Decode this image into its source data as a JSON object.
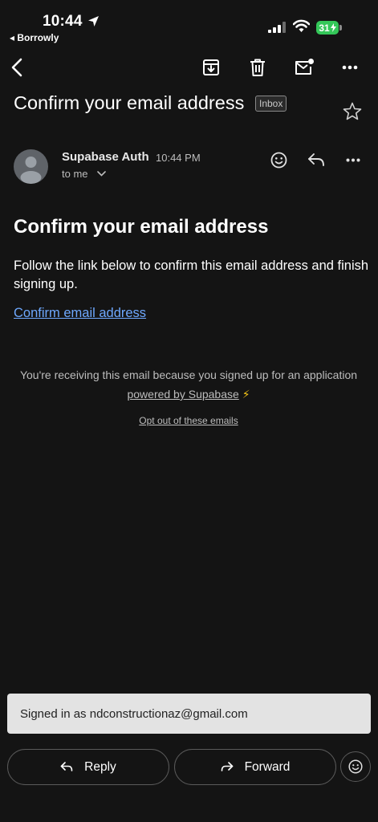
{
  "status_bar": {
    "time": "10:44",
    "back_app": "◂ Borrowly",
    "battery": "31"
  },
  "toolbar": {
    "icons": [
      "back-arrow-icon",
      "archive-icon",
      "trash-icon",
      "mark-unread-icon",
      "more-icon"
    ]
  },
  "email": {
    "subject": "Confirm your email address",
    "label": "Inbox",
    "sender": "Supabase Auth",
    "time": "10:44 PM",
    "recipient": "to me",
    "heading": "Confirm your email address",
    "body": "Follow the link below to confirm this email address and finish signing up.",
    "link_text": "Confirm email address",
    "footer_text": "You're receiving this email because you signed up for an application",
    "footer_link": "powered by Supabase",
    "footer_emoji": "⚡",
    "optout": "Opt out of these emails"
  },
  "bottom": {
    "signed_in": "Signed in as ndconstructionaz@gmail.com",
    "reply_label": "Reply",
    "forward_label": "Forward"
  },
  "colors": {
    "background": "#141414",
    "link": "#6ea8fe",
    "battery": "#34c759"
  }
}
